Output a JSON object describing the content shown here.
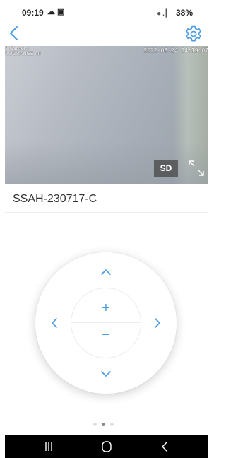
{
  "status_bar": {
    "time": "09:19",
    "left_icons": "☁ ▣",
    "signal": "● . ▎",
    "battery": "38%"
  },
  "header": {
    "back_icon": "chevron-left-icon",
    "settings_icon": "gear-icon",
    "accent_color": "#4a9be0"
  },
  "video": {
    "osd_camera_name": "P Camera",
    "osd_network": "ROORANGE .ııl",
    "osd_timestamp": "2022-08-24 14:19:07",
    "quality_label": "SD",
    "fullscreen_icon": "fullscreen-icon"
  },
  "device": {
    "name": "SSAH-230717-C"
  },
  "ptz": {
    "up_icon": "chevron-up-icon",
    "down_icon": "chevron-down-icon",
    "left_icon": "chevron-left-icon",
    "right_icon": "chevron-right-icon",
    "zoom_in_label": "+",
    "zoom_out_label": "−"
  },
  "pager": {
    "count": 3,
    "active_index": 1
  },
  "nav_bar": {
    "recents_icon": "recents-icon",
    "home_icon": "home-icon",
    "back_icon": "back-icon"
  }
}
